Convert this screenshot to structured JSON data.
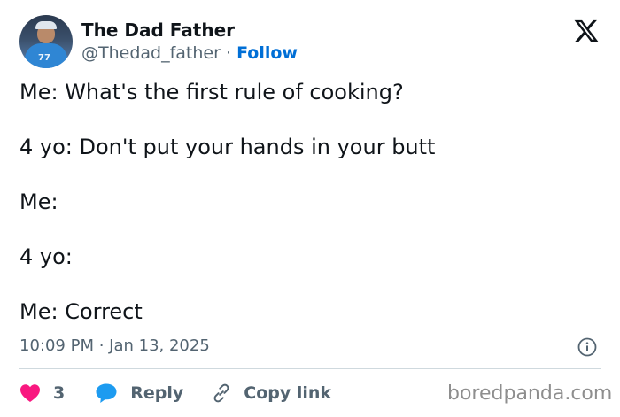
{
  "author": {
    "display_name": "The Dad Father",
    "handle": "@Thedad_father",
    "separator": " · ",
    "follow_label": "Follow",
    "avatar_jersey_number": "77"
  },
  "brand_icon": "x-logo-icon",
  "tweet": {
    "lines": [
      "Me: What's the first rule of cooking?",
      "4 yo: Don't put your hands in your butt",
      "Me:",
      "4 yo:",
      "Me: Correct"
    ],
    "timestamp": "10:09 PM · Jan 13, 2025"
  },
  "actions": {
    "like_count": "3",
    "reply_label": "Reply",
    "copy_link_label": "Copy link"
  },
  "icons": {
    "like": "heart-icon",
    "reply": "speech-bubble-icon",
    "copy": "link-icon",
    "info": "info-icon"
  },
  "colors": {
    "like": "#f91880",
    "reply": "#1d9bf0",
    "follow": "#006fd6",
    "muted": "#536471"
  },
  "watermark": "boredpanda.com"
}
